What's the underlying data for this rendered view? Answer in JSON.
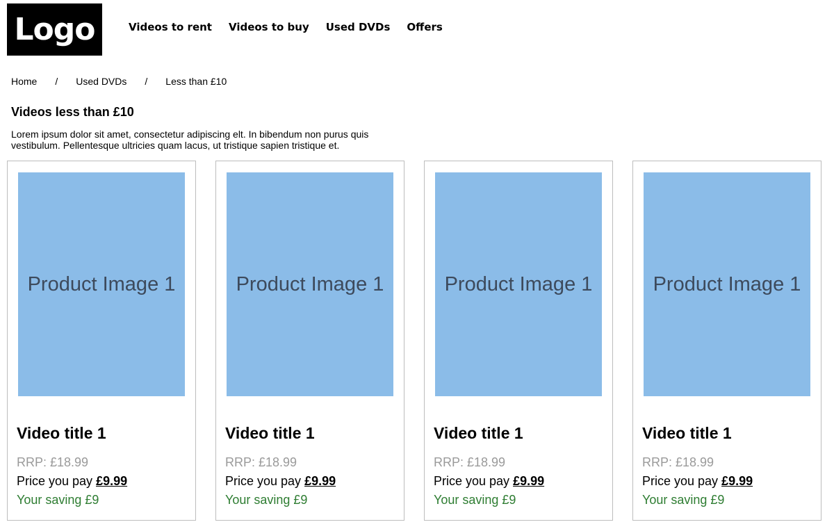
{
  "header": {
    "logo_text": "Logo",
    "nav": [
      {
        "label": "Videos to rent"
      },
      {
        "label": "Videos to buy"
      },
      {
        "label": "Used DVDs"
      },
      {
        "label": "Offers"
      }
    ]
  },
  "breadcrumb": {
    "items": [
      {
        "label": "Home"
      },
      {
        "label": "Used DVDs"
      },
      {
        "label": "Less than £10"
      }
    ],
    "separator": "/"
  },
  "main": {
    "title": "Videos less than £10",
    "intro": "Lorem ipsum dolor sit amet, consectetur adipiscing elt. In bibendum non purus quis vestibulum. Pellentesque ultricies quam lacus, ut tristique sapien tristique et."
  },
  "products": [
    {
      "image_label": "Product Image 1",
      "title": "Video title 1",
      "rrp": "RRP: £18.99",
      "pay_label": "Price you pay",
      "pay_amount": "£9.99",
      "saving": "Your saving £9"
    },
    {
      "image_label": "Product Image 1",
      "title": "Video title 1",
      "rrp": "RRP: £18.99",
      "pay_label": "Price you pay",
      "pay_amount": "£9.99",
      "saving": "Your saving £9"
    },
    {
      "image_label": "Product Image 1",
      "title": "Video title 1",
      "rrp": "RRP: £18.99",
      "pay_label": "Price you pay",
      "pay_amount": "£9.99",
      "saving": "Your saving £9"
    },
    {
      "image_label": "Product Image 1",
      "title": "Video title 1",
      "rrp": "RRP: £18.99",
      "pay_label": "Price you pay",
      "pay_amount": "£9.99",
      "saving": "Your saving £9"
    }
  ],
  "colors": {
    "image_placeholder": "#8bbce8",
    "saving_text": "#2e7d32",
    "rrp_text": "#9a9a9a",
    "card_border": "#bdbdbd"
  }
}
